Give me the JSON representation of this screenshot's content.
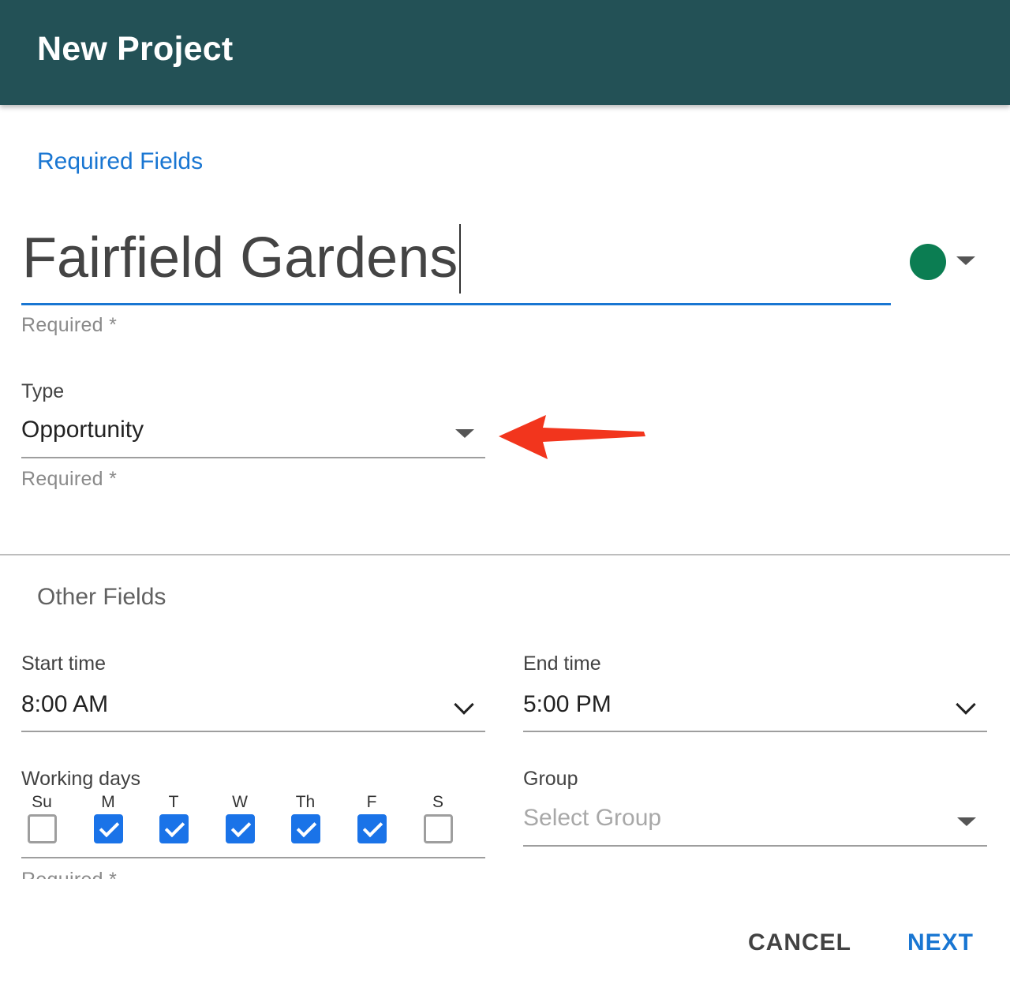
{
  "dialog": {
    "title": "New Project"
  },
  "required_section": {
    "title": "Required Fields",
    "name_field": {
      "value": "Fairfield Gardens",
      "hint": "Required *",
      "color": "#0b7d52"
    },
    "type_field": {
      "label": "Type",
      "value": "Opportunity",
      "hint": "Required *"
    }
  },
  "other_section": {
    "title": "Other Fields",
    "start_time": {
      "label": "Start time",
      "value": "8:00 AM"
    },
    "end_time": {
      "label": "End time",
      "value": "5:00 PM"
    },
    "working_days": {
      "label": "Working days",
      "days": [
        {
          "label": "Su",
          "checked": false
        },
        {
          "label": "M",
          "checked": true
        },
        {
          "label": "T",
          "checked": true
        },
        {
          "label": "W",
          "checked": true
        },
        {
          "label": "Th",
          "checked": true
        },
        {
          "label": "F",
          "checked": true
        },
        {
          "label": "S",
          "checked": false
        }
      ],
      "hint": "Required *"
    },
    "group": {
      "label": "Group",
      "placeholder": "Select Group"
    }
  },
  "actions": {
    "cancel_label": "CANCEL",
    "next_label": "NEXT"
  },
  "colors": {
    "header": "#235156",
    "accent": "#1976d2",
    "checkbox": "#1a73e8",
    "annotation_arrow": "#f2351d"
  }
}
